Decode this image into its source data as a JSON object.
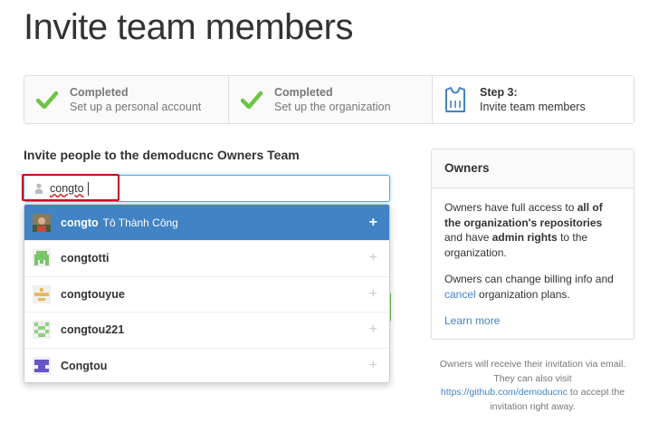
{
  "page": {
    "title": "Invite team members"
  },
  "steps": [
    {
      "status": "Completed",
      "description": "Set up a personal account",
      "icon": "checkmark-icon"
    },
    {
      "status": "Completed",
      "description": "Set up the organization",
      "icon": "checkmark-icon"
    },
    {
      "status": "Step 3:",
      "description": "Invite team members",
      "icon": "shirt-icon"
    }
  ],
  "invite": {
    "heading": "Invite people to the demoducnc Owners Team",
    "search_value": "congto"
  },
  "suggestions": [
    {
      "username": "congto",
      "fullname": "Tô Thành Công",
      "active": true,
      "avatar": "photo-avatar"
    },
    {
      "username": "congtotti",
      "fullname": "",
      "active": false,
      "avatar": "identicon-green"
    },
    {
      "username": "congtouyue",
      "fullname": "",
      "active": false,
      "avatar": "identicon-orange"
    },
    {
      "username": "congtou221",
      "fullname": "",
      "active": false,
      "avatar": "identicon-green-checker"
    },
    {
      "username": "Congtou",
      "fullname": "",
      "active": false,
      "avatar": "identicon-purple"
    }
  ],
  "add_symbol": "+",
  "owners": {
    "title": "Owners",
    "p1_a": "Owners have full access to ",
    "p1_b": "all of the organization's repositories",
    "p1_c": " and have ",
    "p1_d": "admin rights",
    "p1_e": " to the organization.",
    "p2_a": "Owners can change billing info and ",
    "p2_link": "cancel",
    "p2_b": " organization plans.",
    "learn_more": "Learn more"
  },
  "note": {
    "line1": "Owners will receive their invitation via email.",
    "line2": "They can also visit",
    "url": "https://github.com/demoducnc",
    "line3": " to accept the",
    "line4": "invitation right away."
  },
  "colors": {
    "accent": "#4183c4",
    "check": "#6cc644",
    "highlight": "#d0021b"
  }
}
